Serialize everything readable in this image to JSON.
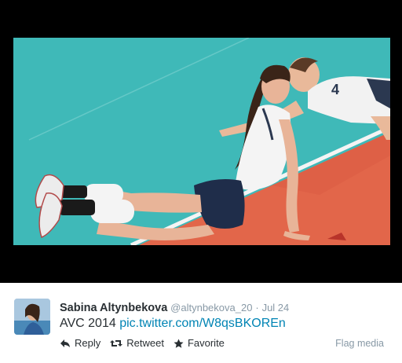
{
  "tweet": {
    "author_name": "Sabina Altynbekova",
    "handle": "@altynbekova_20",
    "separator": "·",
    "date": "Jul 24",
    "text_prefix": "AVC 2014",
    "link_text": "pic.twitter.com/W8qsBKOREn"
  },
  "actions": {
    "reply": "Reply",
    "retweet": "Retweet",
    "favorite": "Favorite",
    "flag_media": "Flag media"
  },
  "photo": {
    "jersey_number": "4"
  },
  "colors": {
    "court_teal": "#3fb9b8",
    "court_orange": "#e2664a",
    "link_blue": "#0084b4",
    "muted_gray": "#8899a6",
    "text_dark": "#292f33"
  }
}
